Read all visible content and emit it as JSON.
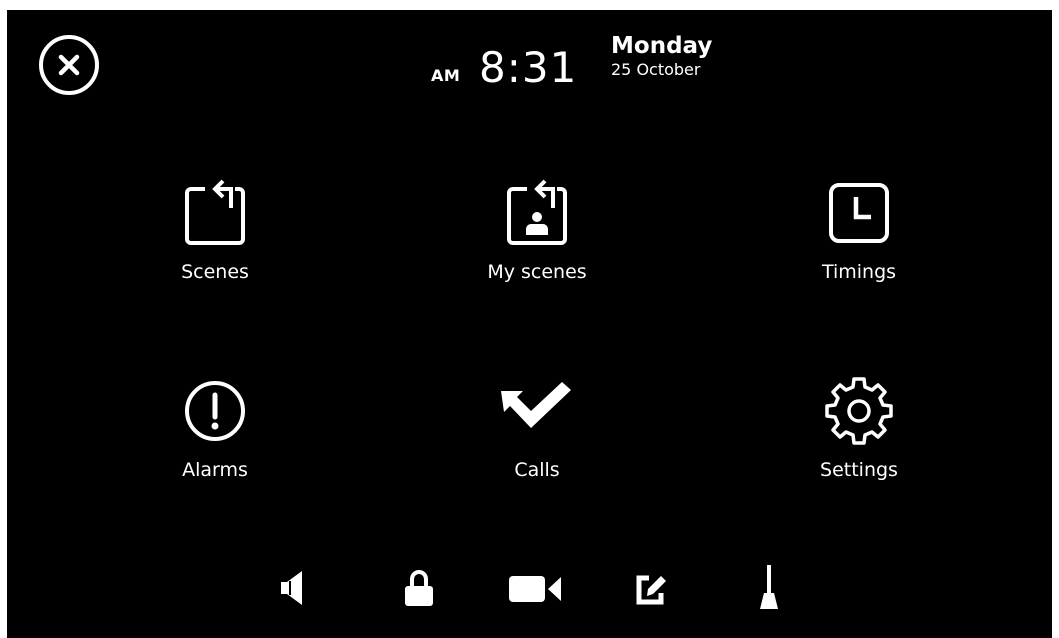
{
  "header": {
    "ampm": "AM",
    "time": "8:31",
    "weekday": "Monday",
    "date": "25 October"
  },
  "menu": {
    "scenes": "Scenes",
    "my_scenes": "My scenes",
    "timings": "Timings",
    "alarms": "Alarms",
    "calls": "Calls",
    "settings": "Settings"
  },
  "toolbar": {
    "icons": [
      "speaker-icon",
      "lock-icon",
      "camera-icon",
      "edit-icon",
      "broom-icon"
    ]
  },
  "colors": {
    "background": "#000000",
    "foreground": "#ffffff"
  }
}
